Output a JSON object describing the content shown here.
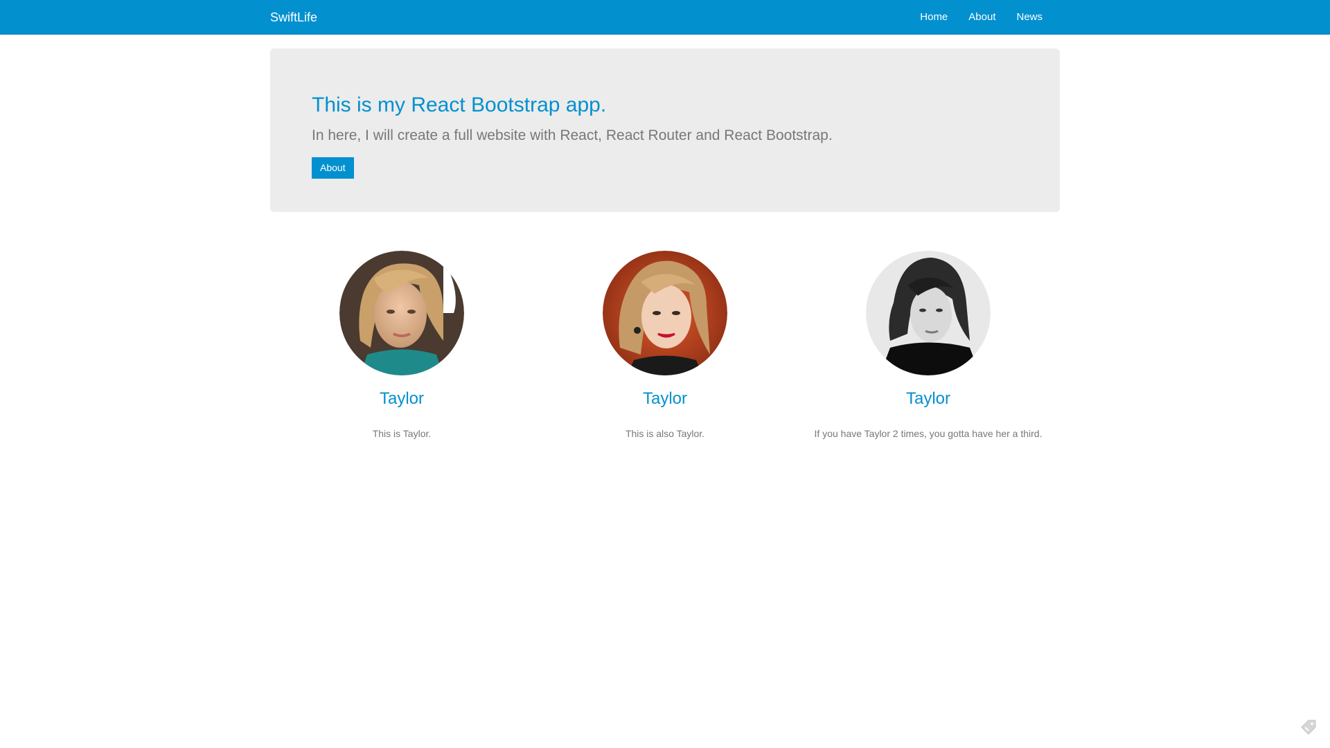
{
  "navbar": {
    "brand": "SwiftLife",
    "links": [
      {
        "label": "Home"
      },
      {
        "label": "About"
      },
      {
        "label": "News"
      }
    ]
  },
  "jumbotron": {
    "title": "This is my React Bootstrap app.",
    "lead": "In here, I will create a full website with React, React Router and React Bootstrap.",
    "button_label": "About"
  },
  "cards": [
    {
      "name": "Taylor",
      "description": "This is Taylor.",
      "image": "portrait-photo-1"
    },
    {
      "name": "Taylor",
      "description": "This is also Taylor.",
      "image": "portrait-photo-2"
    },
    {
      "name": "Taylor",
      "description": "If you have Taylor 2 times, you gotta have her a third.",
      "image": "portrait-photo-3"
    }
  ],
  "colors": {
    "primary": "#0290cf",
    "jumbotron_bg": "#ececec",
    "muted_text": "#777777"
  },
  "corner_widget": {
    "icon": "tag-icon"
  }
}
